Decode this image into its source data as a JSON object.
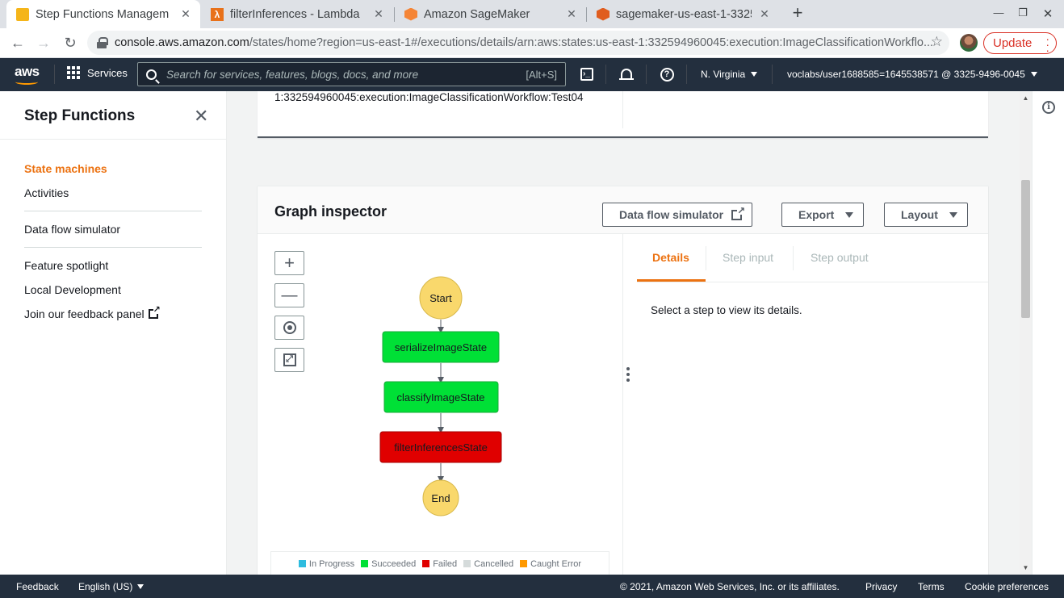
{
  "browser": {
    "tabs": [
      {
        "title": "Step Functions Managem",
        "icon": "aws-favicon",
        "active": true
      },
      {
        "title": "filterInferences - Lambda",
        "icon": "lambda-icon"
      },
      {
        "title": "Amazon SageMaker",
        "icon": "sagemaker-icon"
      },
      {
        "title": "sagemaker-us-east-1-3325",
        "icon": "s3-icon"
      }
    ],
    "url_host": "console.aws.amazon.com",
    "url_path": "/states/home?region=us-east-1#/executions/details/arn:aws:states:us-east-1:332594960045:execution:ImageClassificationWorkflo...",
    "update_label": "Update"
  },
  "aws_nav": {
    "services_label": "Services",
    "search_placeholder": "Search for services, features, blogs, docs, and more",
    "search_shortcut": "[Alt+S]",
    "region": "N. Virginia",
    "account": "voclabs/user1688585=1645538571 @ 3325-9496-0045"
  },
  "sidebar": {
    "title": "Step Functions",
    "items": [
      {
        "label": "State machines",
        "active": true
      },
      {
        "label": "Activities"
      },
      {
        "label": "Data flow simulator"
      },
      {
        "label": "Feature spotlight"
      },
      {
        "label": "Local Development"
      },
      {
        "label": "Join our feedback panel"
      }
    ]
  },
  "execution": {
    "arn_tail": "1:332594960045:execution:ImageClassificationWorkflow:Test04"
  },
  "graph_inspector": {
    "title": "Graph inspector",
    "data_flow_button": "Data flow simulator",
    "export_button": "Export",
    "layout_button": "Layout",
    "nodes": {
      "start": "Start",
      "serialize": "serializeImageState",
      "classify": "classifyImageState",
      "filter": "filterInferencesState",
      "end": "End"
    },
    "node_status": {
      "serialize": "Succeeded",
      "classify": "Succeeded",
      "filter": "Failed"
    },
    "legend": [
      {
        "label": "In Progress",
        "color": "#2ebcdf"
      },
      {
        "label": "Succeeded",
        "color": "#00e036"
      },
      {
        "label": "Failed",
        "color": "#e00000"
      },
      {
        "label": "Cancelled",
        "color": "#d5dbdb"
      },
      {
        "label": "Caught Error",
        "color": "#ff9900"
      }
    ],
    "colors": {
      "terminal": "#f9d86c",
      "succeeded": "#00e036",
      "failed": "#e00000"
    }
  },
  "details": {
    "tabs": [
      "Details",
      "Step input",
      "Step output"
    ],
    "active_tab": "Details",
    "message": "Select a step to view its details."
  },
  "footer": {
    "feedback": "Feedback",
    "language": "English (US)",
    "copyright": "© 2021, Amazon Web Services, Inc. or its affiliates.",
    "privacy": "Privacy",
    "terms": "Terms",
    "cookies": "Cookie preferences"
  }
}
